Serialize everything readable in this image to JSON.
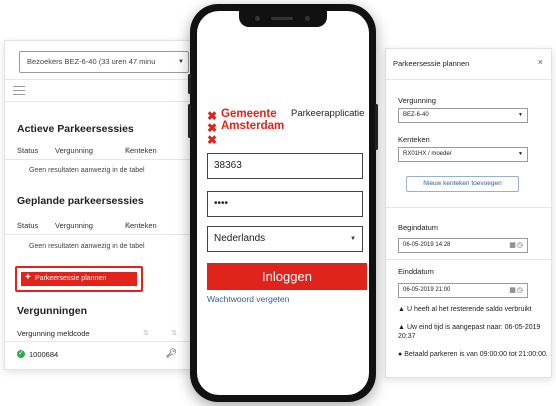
{
  "left": {
    "visitor_select": "Bezoekers BEZ-6-40 (33 uren 47 minu",
    "active_title": "Actieve Parkeersessies",
    "planned_title": "Geplande parkeersessies",
    "columns": {
      "status": "Status",
      "permit": "Vergunning",
      "plate": "Kenteken"
    },
    "empty_text": "Geen resultaten aanwezig in de tabel",
    "plan_button": "Parkeersessie plannen",
    "permits_title": "Vergunningen",
    "permit_column": "Vergunning meldcode",
    "permit_row": "1000684"
  },
  "phone": {
    "logo_lines": [
      "Gemeente",
      "Amsterdam"
    ],
    "app_name": "Parkeerapplicatie",
    "username": "38363",
    "password": "••••",
    "language": "Nederlands",
    "login_button": "Inloggen",
    "forgot_link": "Wachtwoord vergeten"
  },
  "right": {
    "title": "Parkeersessie plannen",
    "close": "×",
    "permit_label": "Vergunning",
    "permit_value": "BEZ-6-40",
    "plate_label": "Kenteken",
    "plate_value": "RX01HX / moeder",
    "add_plate_button": "Nieuw kenteken toevoegen",
    "start_label": "Begindatum",
    "start_value": "06-05-2019 14:28",
    "end_label": "Einddatum",
    "end_value": "06-05-2019 21:00",
    "messages": [
      "U heeft al het resterende saldo verbruikt",
      "Uw eind tijd is aangepast naar: 06-05-2019 20:37",
      "Betaald parkeren is van 09:00:00 tot 21:00:00."
    ]
  },
  "colors": {
    "accent_red": "#e0241b",
    "link_blue": "#2e5f9b",
    "success_green": "#2fa84f"
  },
  "icons": [
    "chevron-down-icon",
    "hamburger-icon",
    "sort-icon",
    "plus-icon",
    "check-circle-icon",
    "key-icon",
    "close-icon",
    "calendar-icon",
    "clock-icon",
    "warning-icon",
    "info-icon",
    "x-mark-icon"
  ]
}
